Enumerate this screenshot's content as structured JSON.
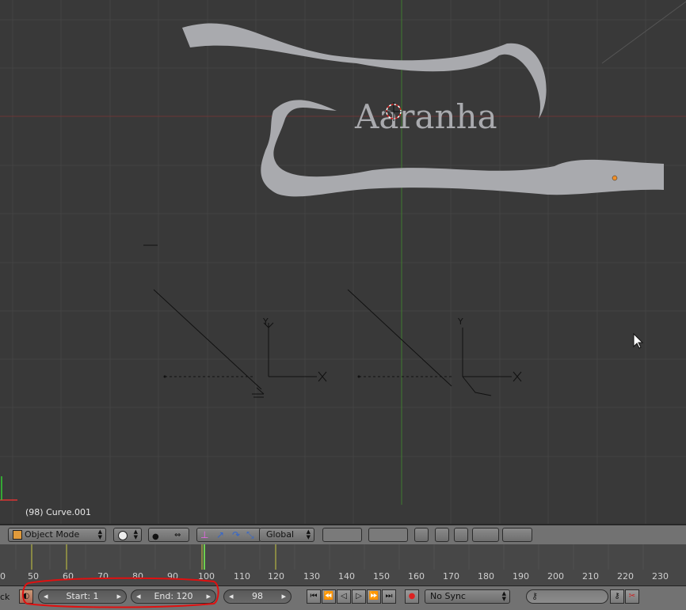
{
  "viewport": {
    "text_object": "Aaranha",
    "object_label": "(98) Curve.001"
  },
  "header": {
    "mode_label": "Object Mode",
    "orientation_label": "Global"
  },
  "timeline": {
    "ticks": [
      "0",
      "50",
      "60",
      "70",
      "80",
      "90",
      "100",
      "110",
      "120",
      "130",
      "140",
      "150",
      "160",
      "170",
      "180",
      "190",
      "200",
      "210",
      "220",
      "230"
    ]
  },
  "footer": {
    "left_cut_label": "ck",
    "start_label": "Start: 1",
    "end_label": "End: 120",
    "frame_value": "98",
    "sync_label": "No Sync"
  },
  "icons": [
    "object-mode-icon",
    "shading-icon",
    "pivot-icon",
    "manipulator-icon",
    "layers-icon",
    "keyframe-icon",
    "record-icon",
    "play-icon",
    "key-icon"
  ],
  "colors": {
    "accent": "#e04040",
    "highlight_circle": "#e01010",
    "playhead": "#6fcf4f"
  }
}
